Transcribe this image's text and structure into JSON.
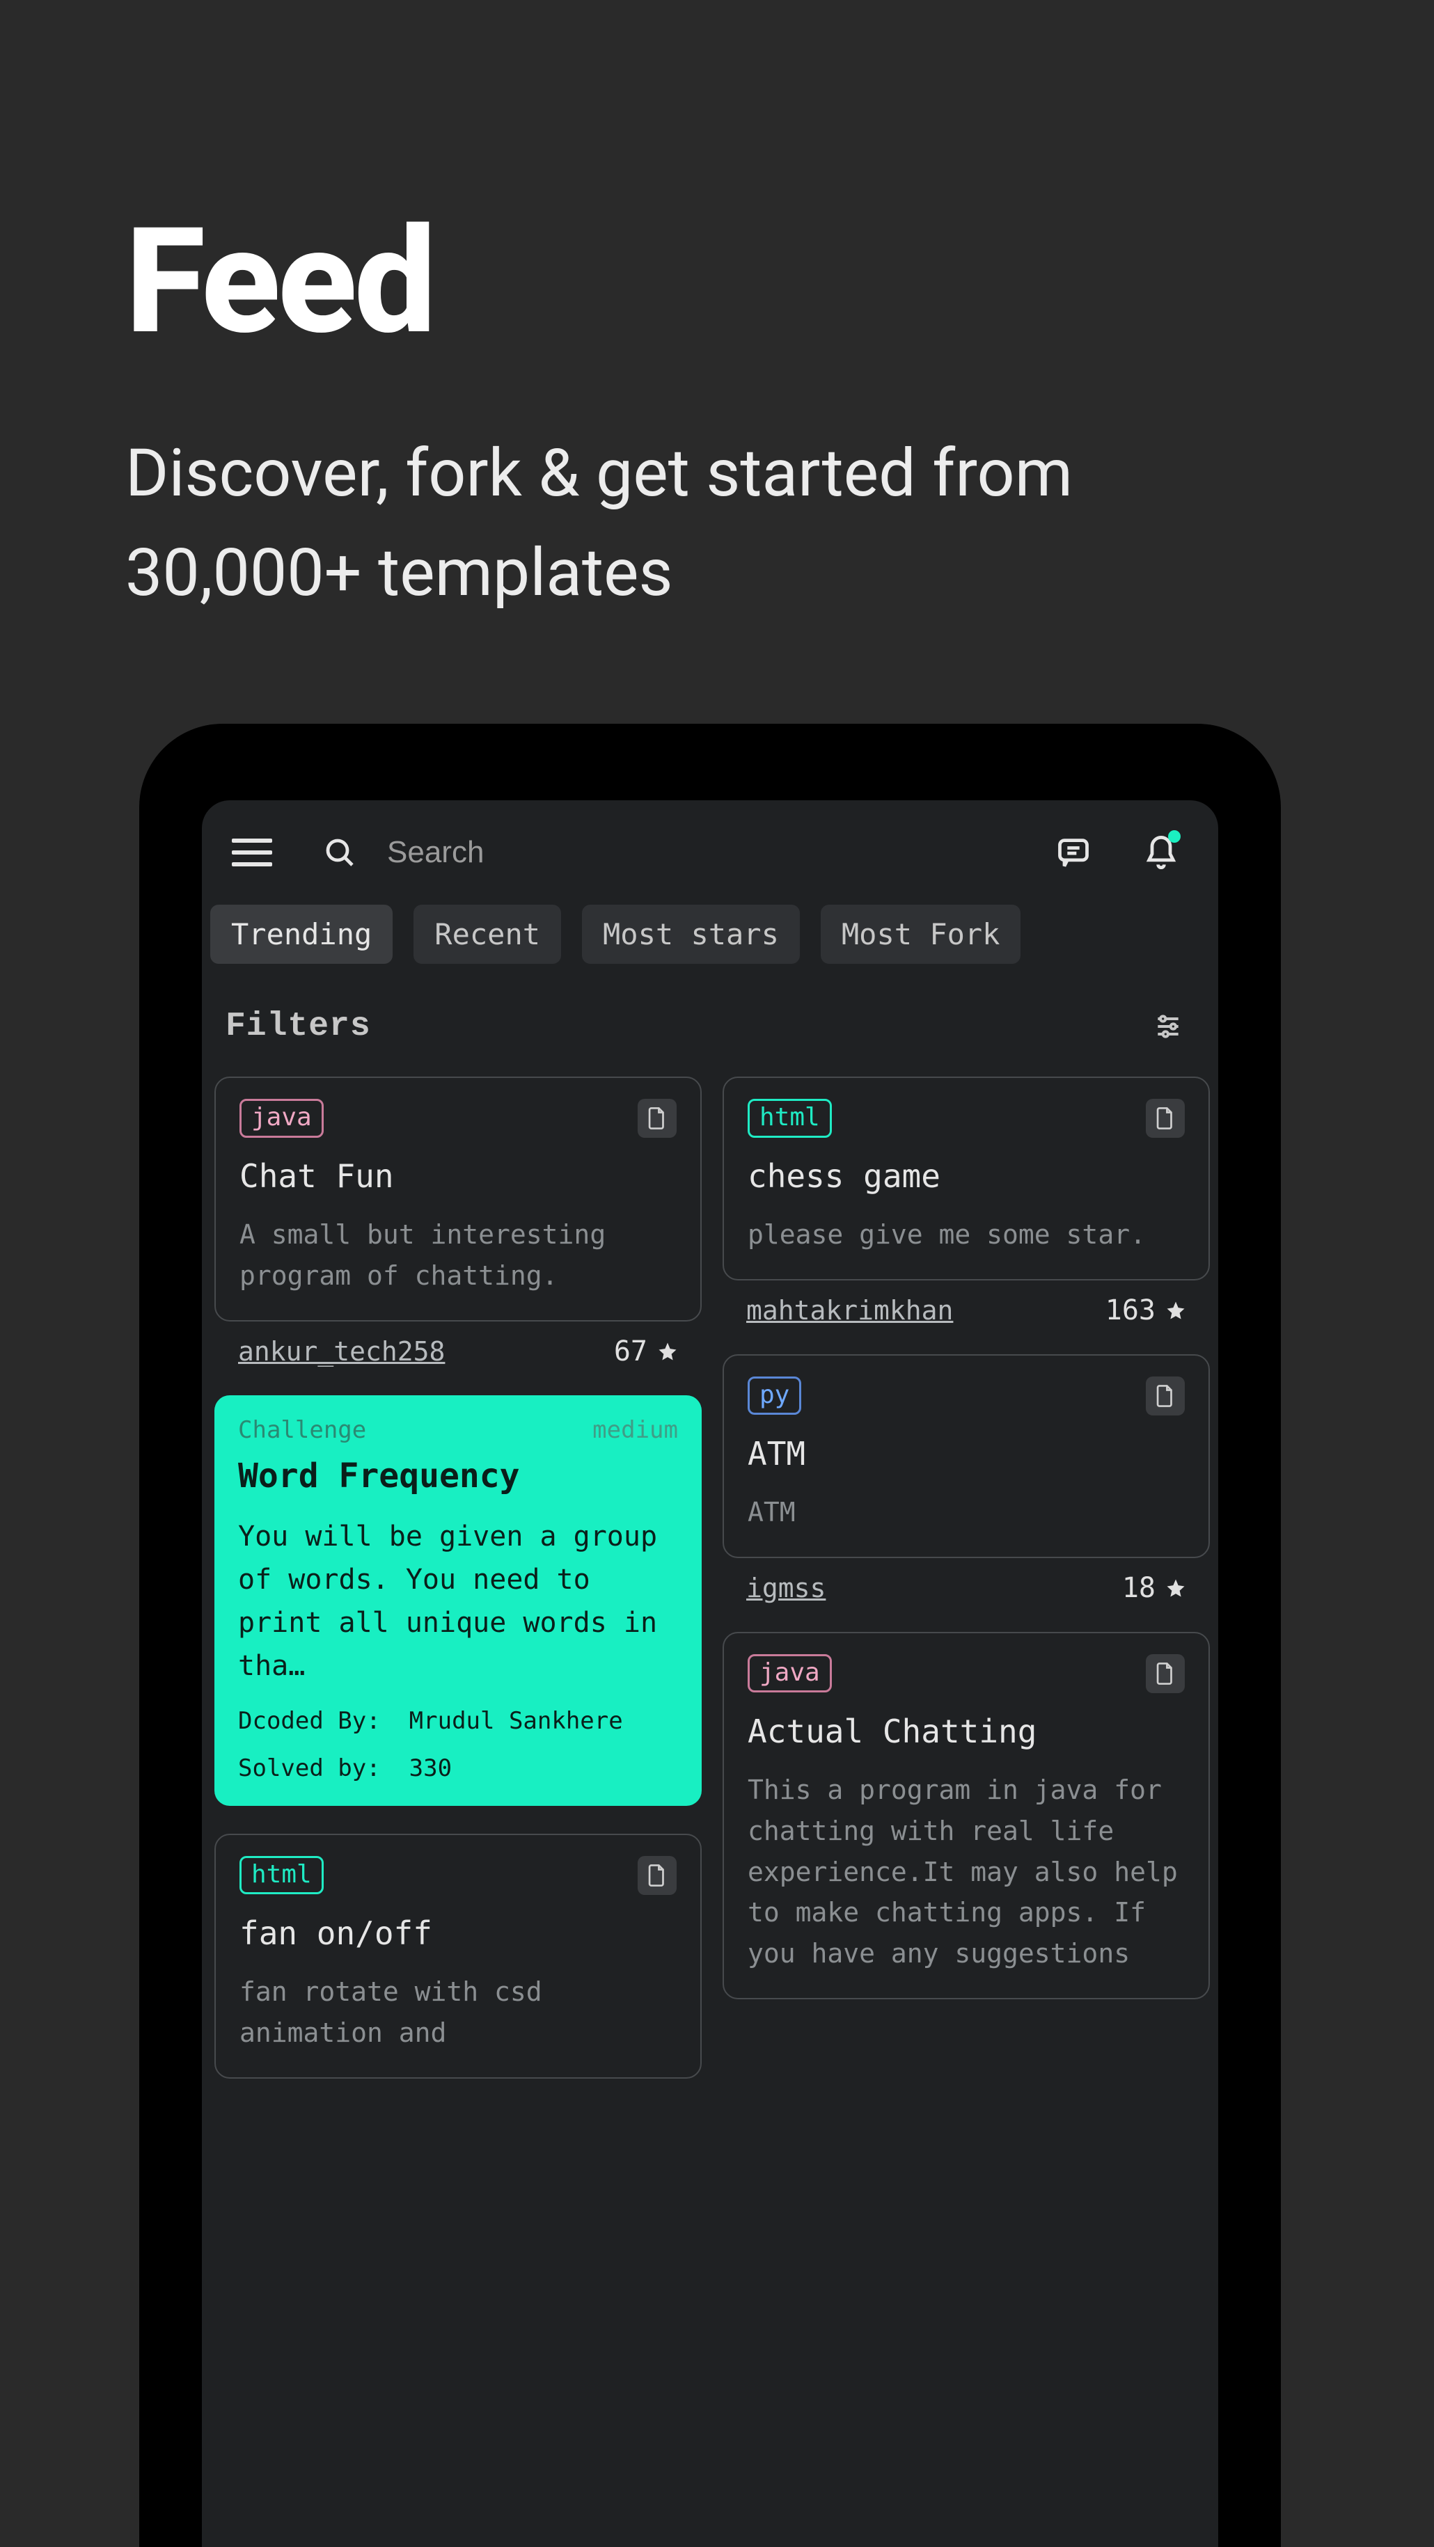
{
  "hero": {
    "title": "Feed",
    "subtitle": "Discover, fork & get started from 30,000+ templates"
  },
  "search": {
    "placeholder": "Search"
  },
  "tabs": [
    {
      "label": "Trending",
      "active": true
    },
    {
      "label": "Recent",
      "active": false
    },
    {
      "label": "Most stars",
      "active": false
    },
    {
      "label": "Most Fork",
      "active": false
    }
  ],
  "filters": {
    "label": "Filters"
  },
  "cards": {
    "left": [
      {
        "type": "project",
        "lang": "java",
        "lang_class": "lang-java",
        "title": "Chat Fun",
        "desc": "A small but interesting program of chatting.",
        "author": "ankur_tech258",
        "stars": "67"
      },
      {
        "type": "challenge",
        "badge": "Challenge",
        "difficulty": "medium",
        "title": "Word Frequency",
        "desc": "You will be given a group of words. You need to print all unique words in tha…",
        "dcoded_label": "Dcoded By:",
        "dcoded_by": "Mrudul Sankhere",
        "solved_label": "Solved by:",
        "solved_by": "330"
      },
      {
        "type": "project",
        "lang": "html",
        "lang_class": "lang-html",
        "title": "fan on/off",
        "desc": "fan rotate with csd animation and",
        "author": "",
        "stars": ""
      }
    ],
    "right": [
      {
        "type": "project",
        "lang": "html",
        "lang_class": "lang-html",
        "title": "chess game",
        "desc": "please give me some star.",
        "author": "mahtakrimkhan",
        "stars": "163"
      },
      {
        "type": "project",
        "lang": "py",
        "lang_class": "lang-py",
        "title": "ATM",
        "desc": "ATM",
        "author": "igmss",
        "stars": "18"
      },
      {
        "type": "project",
        "lang": "java",
        "lang_class": "lang-java",
        "title": "Actual Chatting",
        "desc": "This a program in java for chatting with real life experience.It may also help to make chatting apps. If you have any suggestions",
        "author": "",
        "stars": ""
      }
    ]
  }
}
